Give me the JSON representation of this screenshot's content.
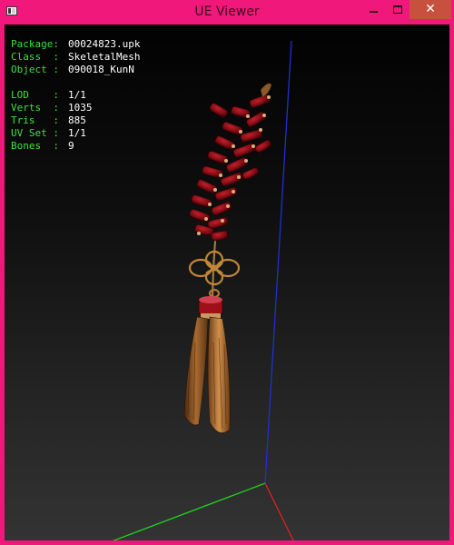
{
  "window": {
    "title": "UE Viewer",
    "close_label": "✕"
  },
  "colors": {
    "frame": "#f0187a",
    "close_button": "#c7503f",
    "label": "#3fe03f",
    "value": "#ffffff",
    "axis_x": "#e02020",
    "axis_y": "#20d020",
    "axis_z": "#2030d0"
  },
  "icons": {
    "app": "app-window-icon",
    "minimize": "minimize-icon",
    "maximize": "maximize-icon",
    "close": "close-icon"
  },
  "info": {
    "package": {
      "label": "Package:",
      "value": "00024823.upk"
    },
    "class": {
      "label": "Class  :",
      "value": "SkeletalMesh"
    },
    "object": {
      "label": "Object :",
      "value": "090018_KunN"
    },
    "lod": {
      "label": "LOD    :",
      "value": "1/1"
    },
    "verts": {
      "label": "Verts  :",
      "value": "1035"
    },
    "tris": {
      "label": "Tris   :",
      "value": "885"
    },
    "uvset": {
      "label": "UV Set :",
      "value": "1/1"
    },
    "bones": {
      "label": "Bones  :",
      "value": "9"
    }
  }
}
